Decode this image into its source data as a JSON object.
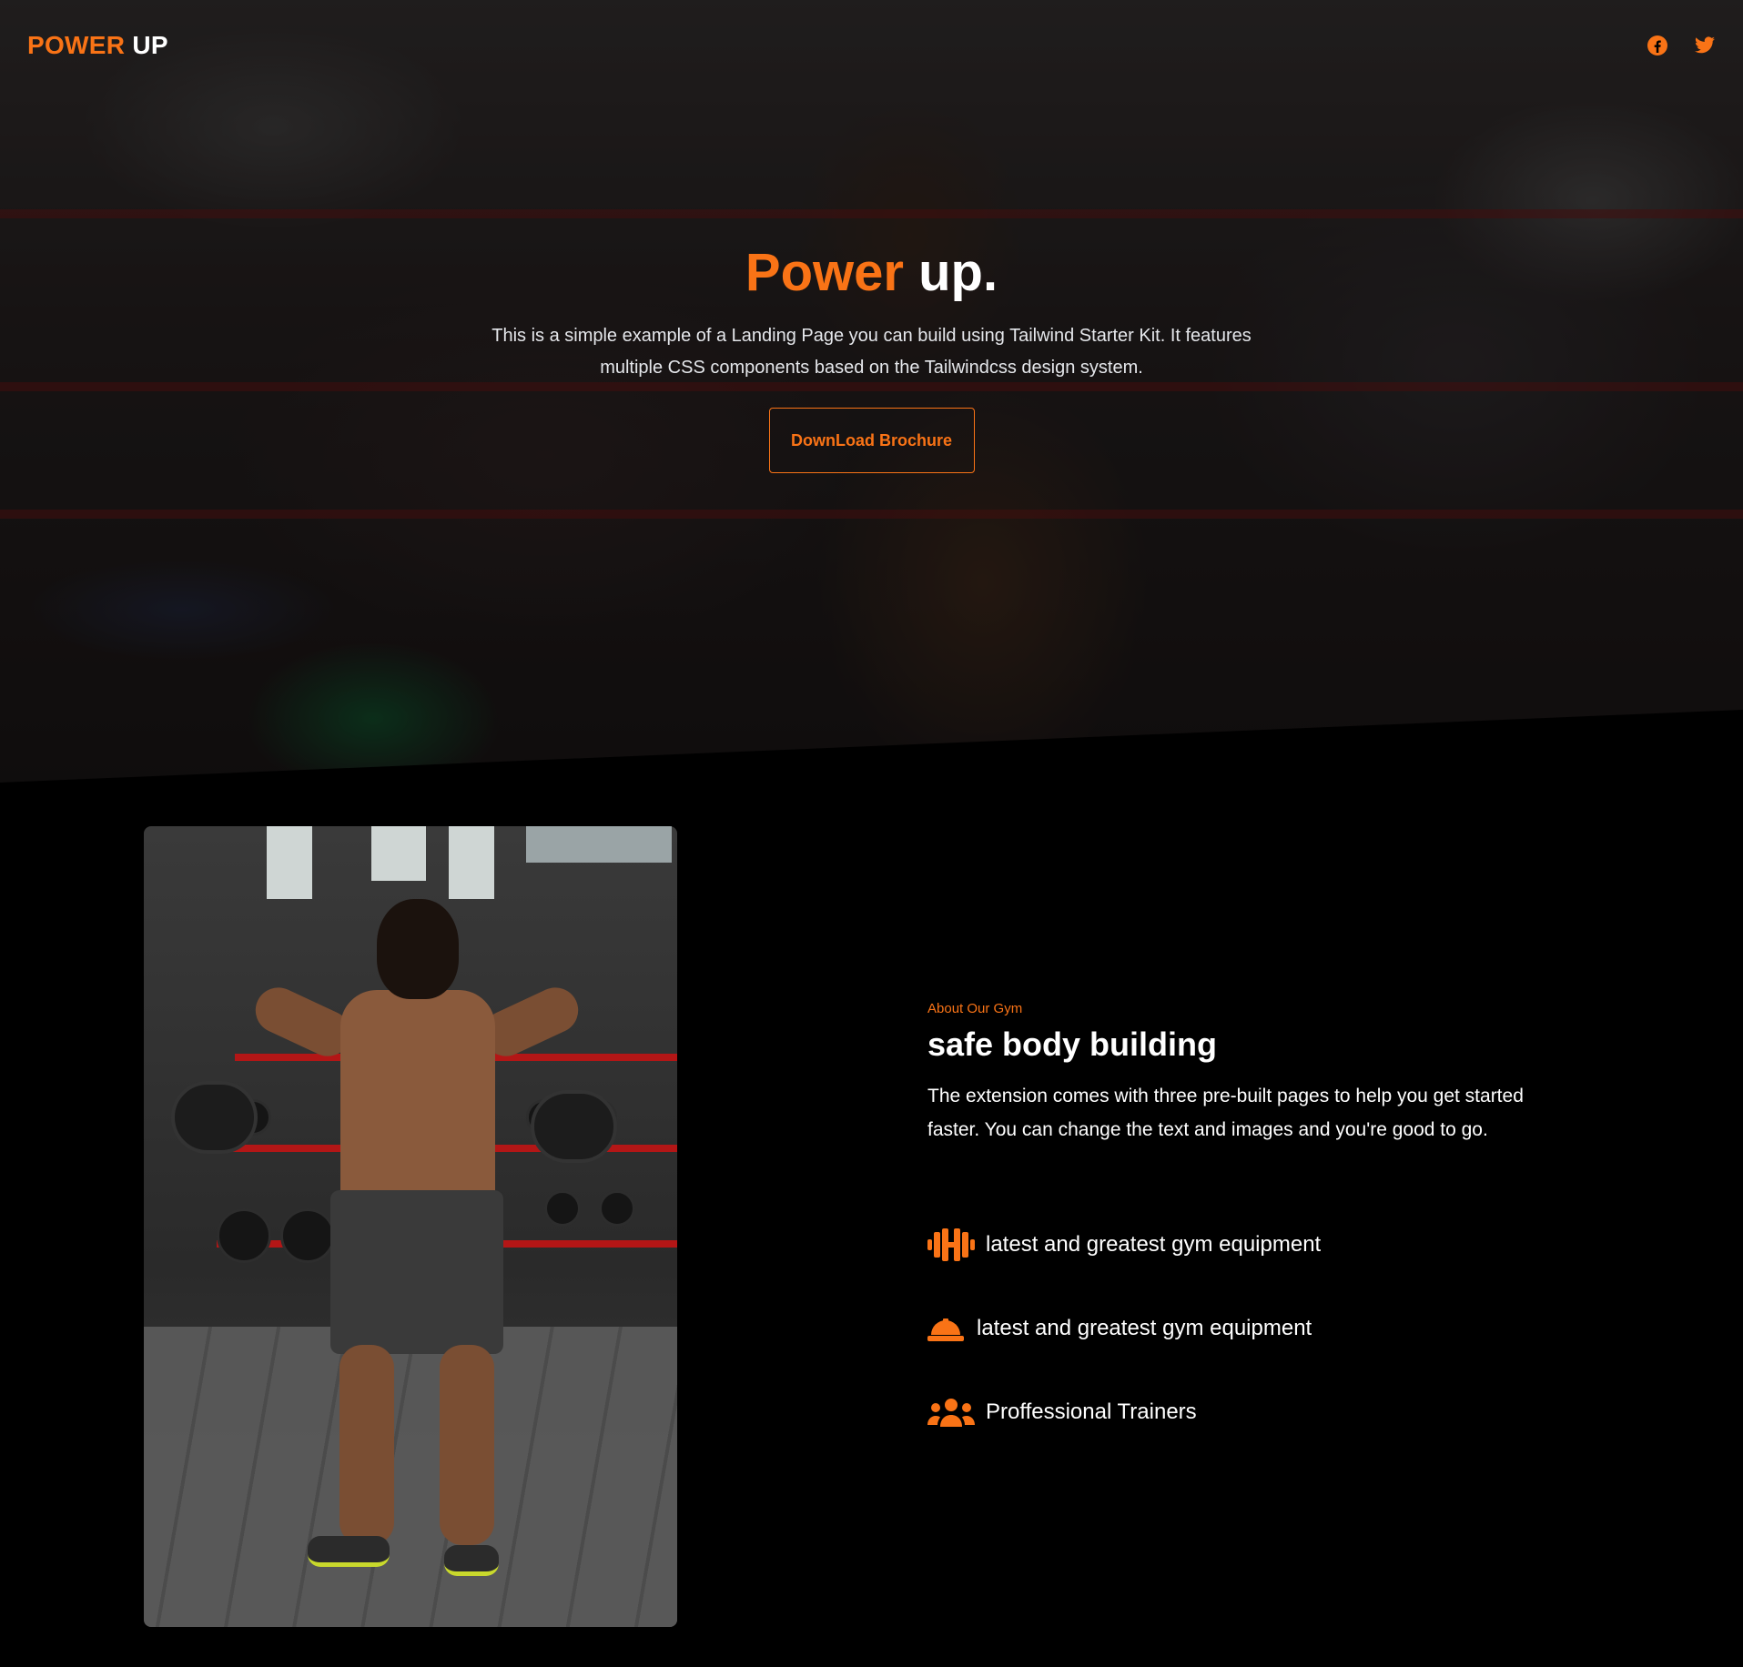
{
  "nav": {
    "brand_part1": "POWER",
    "brand_part2": "UP",
    "social": [
      "facebook-icon",
      "twitter-icon"
    ]
  },
  "hero": {
    "title_part1": "Power",
    "title_part2": "up.",
    "subtitle": "This is a simple example of a Landing Page you can build using Tailwind Starter Kit. It features multiple CSS components based on the Tailwindcss design system.",
    "cta_label": "DownLoad Brochure"
  },
  "about": {
    "eyebrow": "About Our Gym",
    "title": "safe body building",
    "body": "The extension comes with three pre-built pages to help you get started faster. You can change the text and images and you're good to go.",
    "features": [
      {
        "icon": "dumbbell-icon",
        "label": "latest and greatest gym equipment"
      },
      {
        "icon": "hard-hat-icon",
        "label": "latest and greatest gym equipment"
      },
      {
        "icon": "users-icon",
        "label": "Proffessional Trainers"
      }
    ]
  },
  "colors": {
    "accent": "#f97316",
    "background": "#000000",
    "text": "#ffffff"
  }
}
